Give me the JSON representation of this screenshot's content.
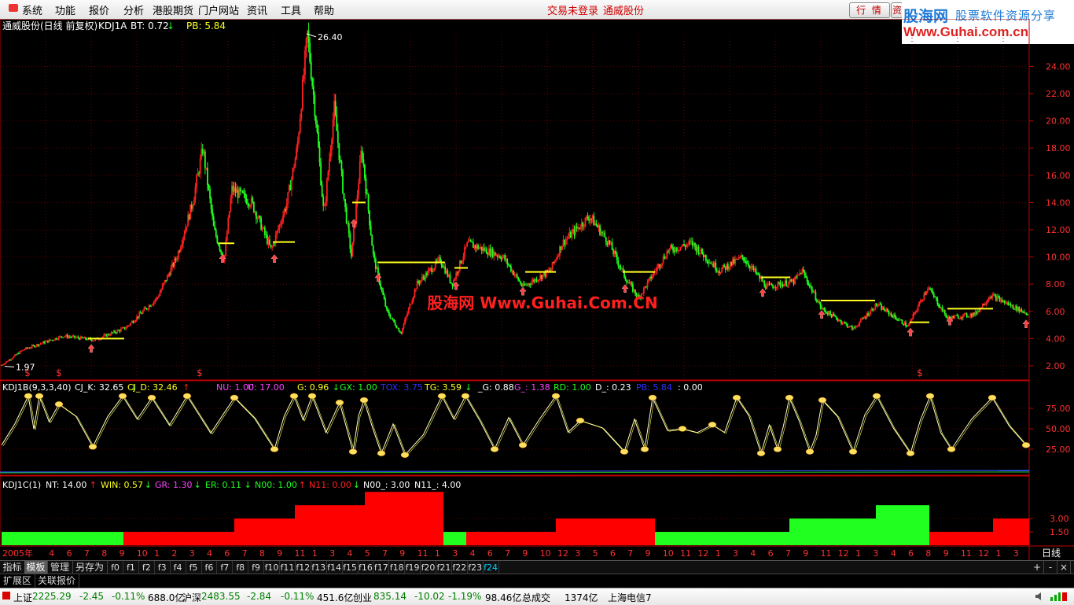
{
  "menu": {
    "items": [
      "系统",
      "功能",
      "报价",
      "分析",
      "港股期货",
      "门户网站",
      "资讯",
      "工具",
      "帮助"
    ],
    "login_status": "交易未登录",
    "stock_name": "通威股份",
    "quote_button": "行 情",
    "info_button": "资"
  },
  "logo": {
    "brand": "股海网",
    "slogan": "股票软件资源分享",
    "url": "Www.Guhai.com.cn"
  },
  "watermark": "股海网 Www.Guhai.Com.CN",
  "colors": {
    "up": "#ff2020",
    "down": "#20ff20",
    "axis": "#c00000",
    "grid": "#6a0000",
    "yellow": "#ffff20",
    "accent": "#ffdf60"
  },
  "main_panel": {
    "title": "通威股份(日线 前复权)",
    "indicator": "KDJ1A",
    "fields": [
      {
        "label": "BT: 0.72",
        "arrow": "↓",
        "color": "#ffffff"
      },
      {
        "label": "PB: 5.84",
        "arrow": "",
        "color": "#ffff20"
      }
    ],
    "high_label": "26.40",
    "low_label": "1.97",
    "y_ticks": [
      "24.00",
      "22.00",
      "20.00",
      "18.00",
      "16.00",
      "14.00",
      "12.00",
      "10.00",
      "8.00",
      "6.00",
      "4.00",
      "2.00"
    ],
    "signal_marks": [
      "$",
      "$",
      "$",
      "$"
    ]
  },
  "kdj_panel": {
    "name": "KDJ1B(9,3,3,40)",
    "fields": [
      {
        "label": "CJ_K: 32.65",
        "arrow": "↓",
        "color": "#ffffff"
      },
      {
        "label": "CJ_D: 32.46",
        "arrow": "↑",
        "color": "#ffff20"
      },
      {
        "label": "NU: 1.00",
        "arrow": "",
        "color": "#ff40ff"
      },
      {
        "label": "U: 17.00",
        "arrow": "",
        "color": "#ff40ff"
      },
      {
        "label": "G: 0.96",
        "arrow": "↓",
        "color": "#ffff20"
      },
      {
        "label": "GX: 1.00",
        "arrow": "",
        "color": "#20ff20"
      },
      {
        "label": "TOX: 3.75",
        "arrow": "",
        "color": "#3030ff"
      },
      {
        "label": "TG: 3.59",
        "arrow": "↓",
        "color": "#ffff20"
      },
      {
        "label": "_G: 0.88",
        "arrow": "",
        "color": "#ffffff"
      },
      {
        "label": "G_: 1.38",
        "arrow": "",
        "color": "#ff40ff"
      },
      {
        "label": "RD: 1.00",
        "arrow": "",
        "color": "#20ff20"
      },
      {
        "label": "D_: 0.23",
        "arrow": "",
        "color": "#ffffff"
      },
      {
        "label": "PB: 5.84",
        "arrow": "",
        "color": "#3030ff"
      },
      {
        "label": ": 0.00",
        "arrow": "",
        "color": "#ffffff"
      }
    ],
    "y_ticks": [
      "75.00",
      "50.00",
      "25.00"
    ]
  },
  "kdj1c_panel": {
    "name": "KDJ1C(1)",
    "fields": [
      {
        "label": "NT: 14.00",
        "arrow": "↑",
        "color": "#ffffff"
      },
      {
        "label": "WIN: 0.57",
        "arrow": "↓",
        "color": "#ffff20"
      },
      {
        "label": "GR: 1.30",
        "arrow": "↓",
        "color": "#ff40ff"
      },
      {
        "label": "ER: 0.11",
        "arrow": "↓",
        "color": "#20ff20"
      },
      {
        "label": "N00: 1.00",
        "arrow": "↑",
        "color": "#20ff20"
      },
      {
        "label": "N11: 0.00",
        "arrow": "↓",
        "color": "#ff2020"
      },
      {
        "label": "N00_: 3.00",
        "arrow": "",
        "color": "#ffffff"
      },
      {
        "label": "N11_: 4.00",
        "arrow": "",
        "color": "#ffffff"
      }
    ],
    "y_ticks": [
      "3.00",
      "1.50"
    ]
  },
  "time_axis": {
    "labels": [
      "2005年",
      "4",
      "6",
      "7",
      "8",
      "9",
      "10",
      "1",
      "2",
      "3",
      "4",
      "6",
      "7",
      "8",
      "9",
      "11",
      "1",
      "3",
      "4",
      "5",
      "7",
      "9",
      "11",
      "1",
      "3",
      "4",
      "6",
      "7",
      "9",
      "10",
      "12",
      "3",
      "5",
      "6",
      "7",
      "9",
      "10",
      "11",
      "12",
      "1",
      "3",
      "4",
      "6",
      "7",
      "9",
      "11",
      "12",
      "1",
      "3",
      "4",
      "6",
      "8",
      "9",
      "11",
      "12",
      "1",
      "3"
    ],
    "period": "日线"
  },
  "tabs": {
    "left": [
      "指标",
      "模板",
      "管理",
      "另存为"
    ],
    "active_left": "模板",
    "formula_tabs": [
      "f0",
      "f1",
      "f2",
      "f3",
      "f4",
      "f5",
      "f6",
      "f7",
      "f8",
      "f9",
      "f10",
      "f11",
      "f12",
      "f13",
      "f14",
      "f15",
      "f16",
      "f17",
      "f18",
      "f19",
      "f20",
      "f21",
      "f22",
      "f23",
      "f24"
    ],
    "active_formula": "f24",
    "ctrl": [
      "+",
      "-",
      "×"
    ]
  },
  "ext_tabs": [
    "扩展区",
    "关联报价"
  ],
  "status": {
    "sh_name": "上证",
    "sh_val": "2225.29",
    "sh_chg": "-2.45",
    "sh_pct": "-0.11%",
    "sh_amt": "688.0亿",
    "hs_name": "沪深",
    "hs_val": "2483.55",
    "hs_chg": "-2.84",
    "hs_pct": "-0.11%",
    "hs_amt": "451.6亿",
    "cy_name": "创业",
    "cy_val": "835.14",
    "cy_chg": "-10.02",
    "cy_pct": "-1.19%",
    "cy_amt": "98.46亿",
    "total_label": "总成交",
    "total_val": "1374亿",
    "broker": "上海电信7"
  }
}
